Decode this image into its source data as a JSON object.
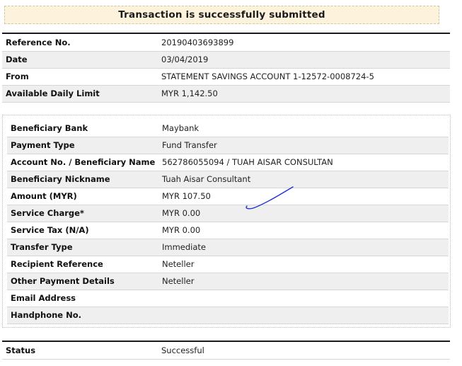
{
  "banner": {
    "message": "Transaction is successfully submitted"
  },
  "account_info": [
    {
      "label": "Reference No.",
      "value": "20190403693899"
    },
    {
      "label": "Date",
      "value": "03/04/2019"
    },
    {
      "label": "From",
      "value": "STATEMENT SAVINGS ACCOUNT 1-12572-0008724-5"
    },
    {
      "label": "Available Daily Limit",
      "value": "MYR 1,142.50"
    }
  ],
  "transfer_details": [
    {
      "label": "Beneficiary Bank",
      "value": "Maybank"
    },
    {
      "label": "Payment Type",
      "value": "Fund Transfer"
    },
    {
      "label": "Account No. / Beneficiary Name",
      "value": "562786055094 / TUAH AISAR CONSULTAN"
    },
    {
      "label": "Beneficiary Nickname",
      "value": "Tuah Aisar Consultant"
    },
    {
      "label": "Amount (MYR)",
      "value": "MYR 107.50"
    },
    {
      "label": "Service Charge*",
      "value": "MYR 0.00"
    },
    {
      "label": "Service Tax (N/A)",
      "value": "MYR 0.00"
    },
    {
      "label": "Transfer Type",
      "value": "Immediate"
    },
    {
      "label": "Recipient Reference",
      "value": "Neteller"
    },
    {
      "label": "Other Payment Details",
      "value": "Neteller"
    },
    {
      "label": "Email Address",
      "value": ""
    },
    {
      "label": "Handphone No.",
      "value": ""
    }
  ],
  "status": {
    "label": "Status",
    "value": "Successful"
  },
  "annotation": {
    "stroke_color": "#1f2fd6"
  }
}
